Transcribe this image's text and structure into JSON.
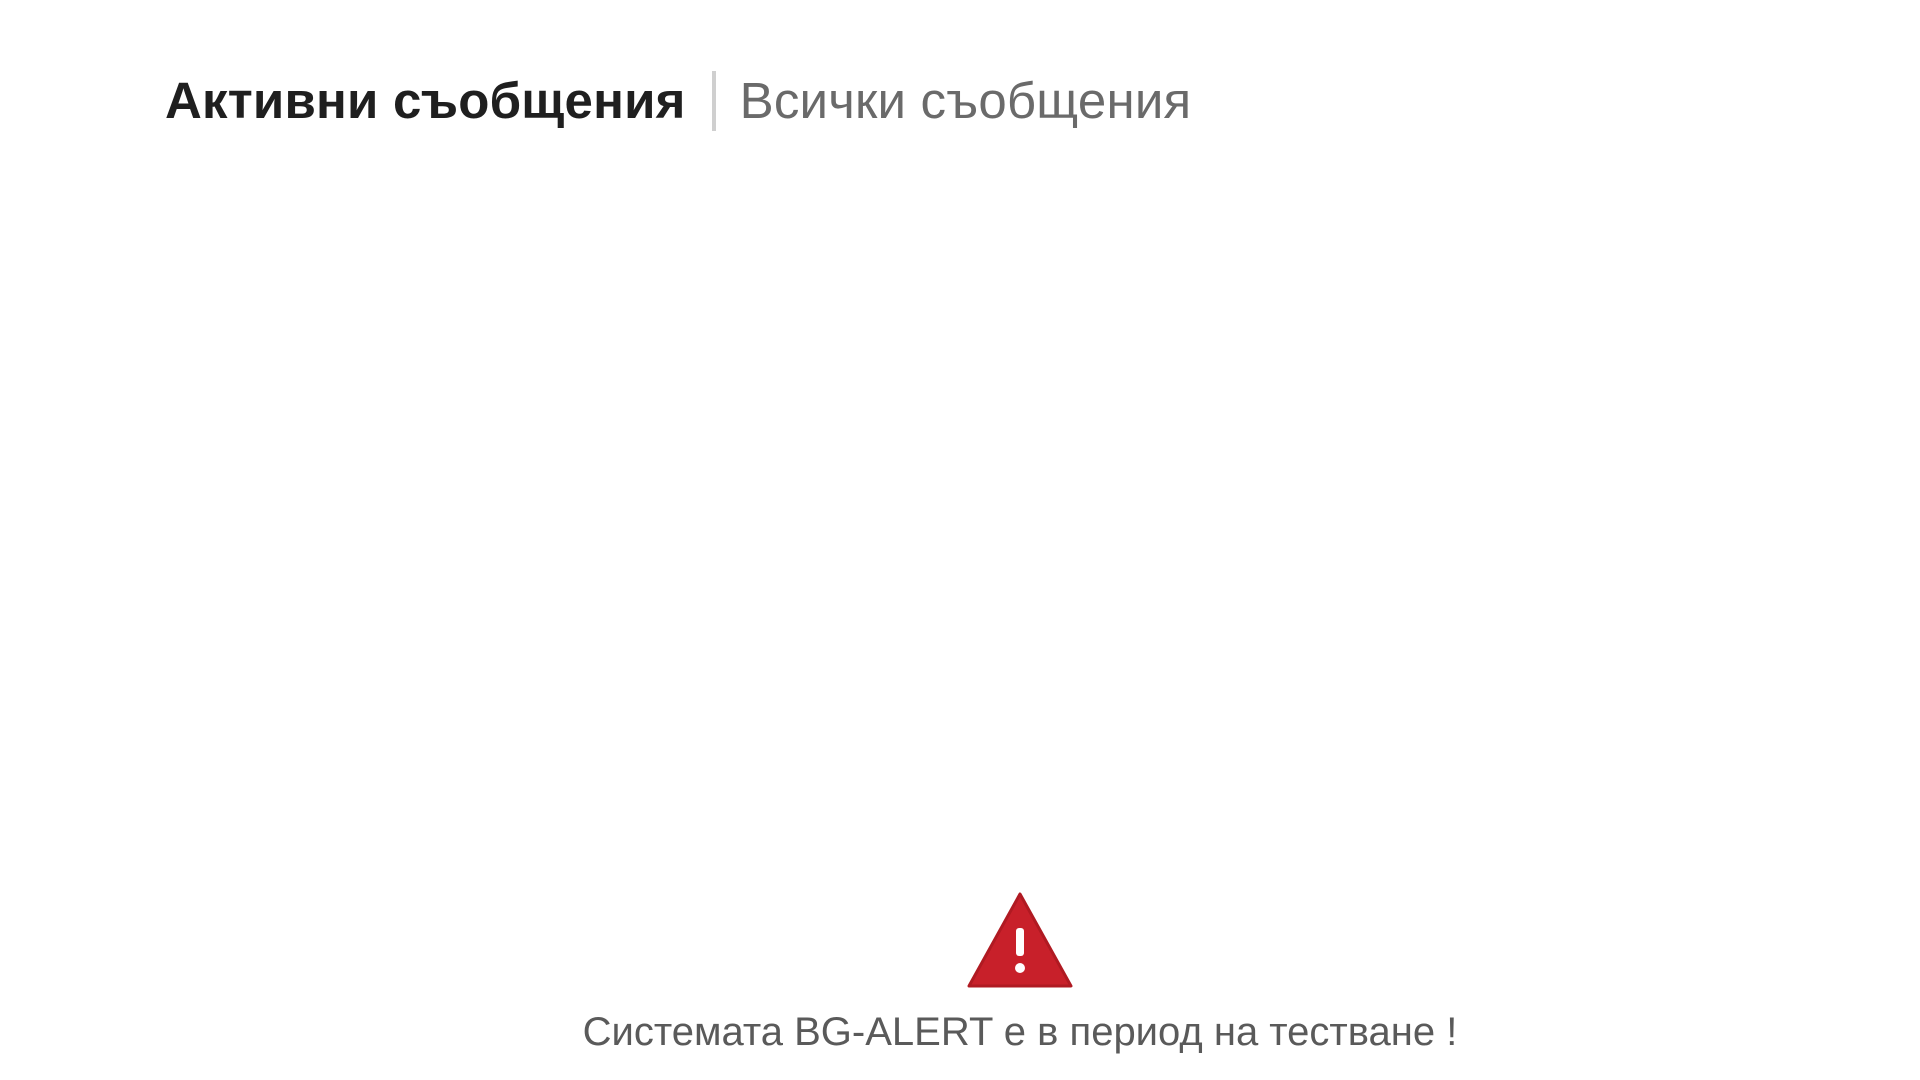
{
  "tabs": {
    "active_label": "Активни съобщения",
    "all_label": "Всички съобщения"
  },
  "notice": {
    "icon": "warning-triangle-icon",
    "icon_color": "#c8202a",
    "text": "Системата BG-ALERT е в период на тестване !"
  }
}
